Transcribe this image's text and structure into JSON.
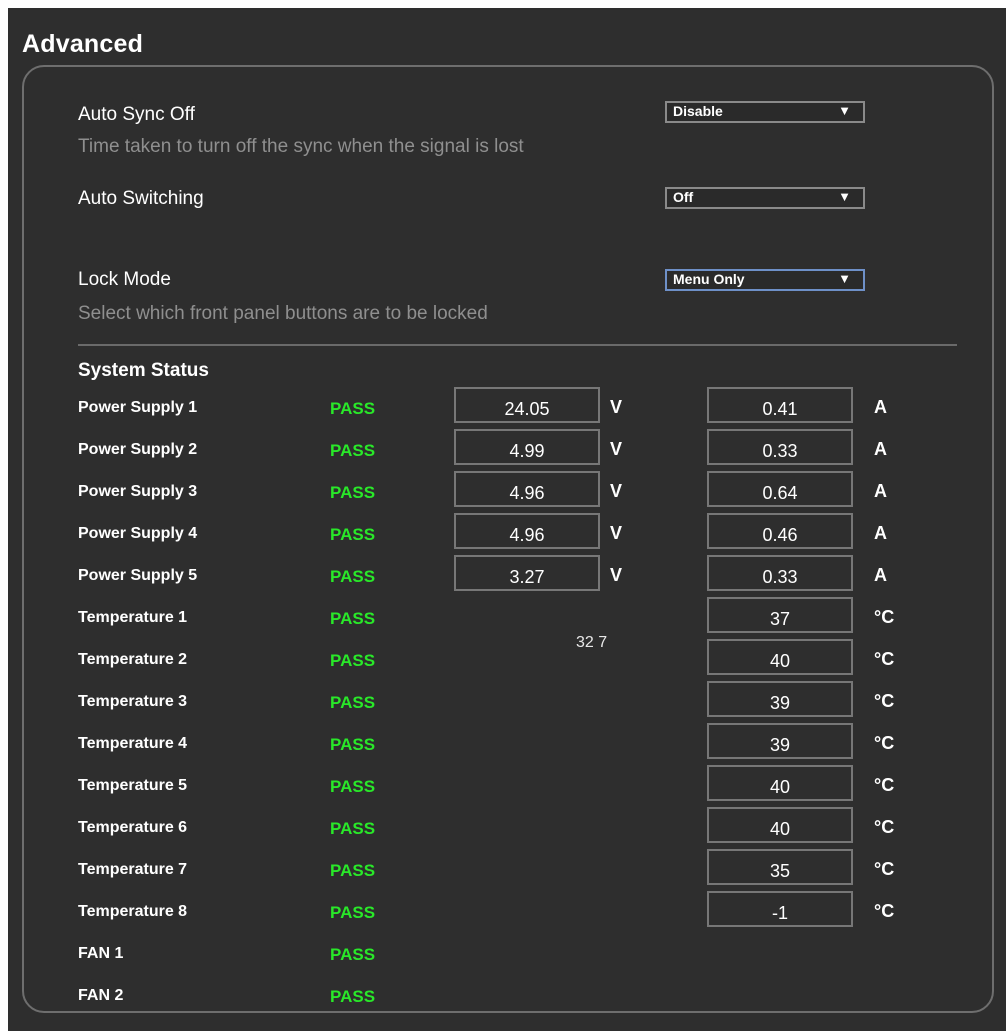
{
  "page": {
    "title": "Advanced"
  },
  "settings": {
    "auto_sync_off": {
      "label": "Auto Sync Off",
      "description": "Time taken to turn off the sync when the signal is lost",
      "value": "Disable"
    },
    "auto_switching": {
      "label": "Auto Switching",
      "value": "Off"
    },
    "lock_mode": {
      "label": "Lock Mode",
      "description": "Select which front panel buttons are to be locked",
      "value": "Menu Only"
    }
  },
  "system_status": {
    "title": "System Status",
    "misc_text": "32 7",
    "rows": [
      {
        "label": "Power Supply 1",
        "status": "PASS",
        "voltage": "24.05",
        "voltage_unit": "V",
        "current": "0.41",
        "current_unit": "A"
      },
      {
        "label": "Power Supply 2",
        "status": "PASS",
        "voltage": "4.99",
        "voltage_unit": "V",
        "current": "0.33",
        "current_unit": "A"
      },
      {
        "label": "Power Supply 3",
        "status": "PASS",
        "voltage": "4.96",
        "voltage_unit": "V",
        "current": "0.64",
        "current_unit": "A"
      },
      {
        "label": "Power Supply 4",
        "status": "PASS",
        "voltage": "4.96",
        "voltage_unit": "V",
        "current": "0.46",
        "current_unit": "A"
      },
      {
        "label": "Power Supply 5",
        "status": "PASS",
        "voltage": "3.27",
        "voltage_unit": "V",
        "current": "0.33",
        "current_unit": "A"
      },
      {
        "label": "Temperature 1",
        "status": "PASS",
        "temperature": "37",
        "temperature_unit": "°C"
      },
      {
        "label": "Temperature 2",
        "status": "PASS",
        "temperature": "40",
        "temperature_unit": "°C"
      },
      {
        "label": "Temperature 3",
        "status": "PASS",
        "temperature": "39",
        "temperature_unit": "°C"
      },
      {
        "label": "Temperature 4",
        "status": "PASS",
        "temperature": "39",
        "temperature_unit": "°C"
      },
      {
        "label": "Temperature 5",
        "status": "PASS",
        "temperature": "40",
        "temperature_unit": "°C"
      },
      {
        "label": "Temperature 6",
        "status": "PASS",
        "temperature": "40",
        "temperature_unit": "°C"
      },
      {
        "label": "Temperature 7",
        "status": "PASS",
        "temperature": "35",
        "temperature_unit": "°C"
      },
      {
        "label": "Temperature 8",
        "status": "PASS",
        "temperature": "-1",
        "temperature_unit": "°C"
      },
      {
        "label": "FAN 1",
        "status": "PASS"
      },
      {
        "label": "FAN 2",
        "status": "PASS"
      }
    ]
  },
  "colors": {
    "background": "#2e2e2e",
    "pass": "#29e829",
    "text": "#ffffff",
    "muted": "#8f8f8f"
  },
  "icons": {
    "dropdown": "caret-down-icon"
  }
}
